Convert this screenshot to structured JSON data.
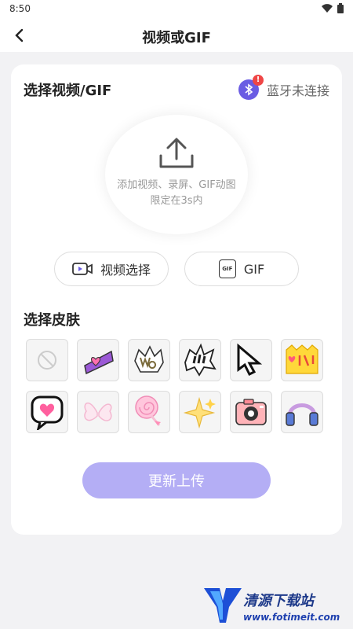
{
  "status": {
    "time": "8:50"
  },
  "header": {
    "title": "视频或GIF"
  },
  "select_video": {
    "title": "选择视频/GIF",
    "bluetooth_text": "蓝牙未连接",
    "bluetooth_badge": "!",
    "upload_hint_line1": "添加视频、录屏、GIF动图",
    "upload_hint_line2": "限定在3s内",
    "video_button": "视频选择",
    "gif_button": "GIF",
    "gif_icon_text": "GIF"
  },
  "skins": {
    "title": "选择皮肤",
    "items": [
      {
        "name": "none",
        "icon": "no-symbol"
      },
      {
        "name": "love",
        "icon": "love-text"
      },
      {
        "name": "wow",
        "icon": "wow-text"
      },
      {
        "name": "exclaim-bubble",
        "icon": "exclaim-bubble"
      },
      {
        "name": "pixel-cursor",
        "icon": "cursor"
      },
      {
        "name": "heart-jump",
        "icon": "heart-text"
      },
      {
        "name": "pixel-heart-bubble",
        "icon": "heart-bubble"
      },
      {
        "name": "butterfly",
        "icon": "butterfly"
      },
      {
        "name": "lollipop",
        "icon": "lollipop"
      },
      {
        "name": "sparkle",
        "icon": "sparkle"
      },
      {
        "name": "camera",
        "icon": "camera"
      },
      {
        "name": "headphones",
        "icon": "headphones"
      }
    ]
  },
  "update_button": "更新上传",
  "watermark": {
    "brand": "清源下载站",
    "site": "www.fotimeit.com"
  },
  "colors": {
    "accent": "#6a5ce3",
    "button_disabled": "#b4aef5",
    "badge": "#ef4646"
  }
}
